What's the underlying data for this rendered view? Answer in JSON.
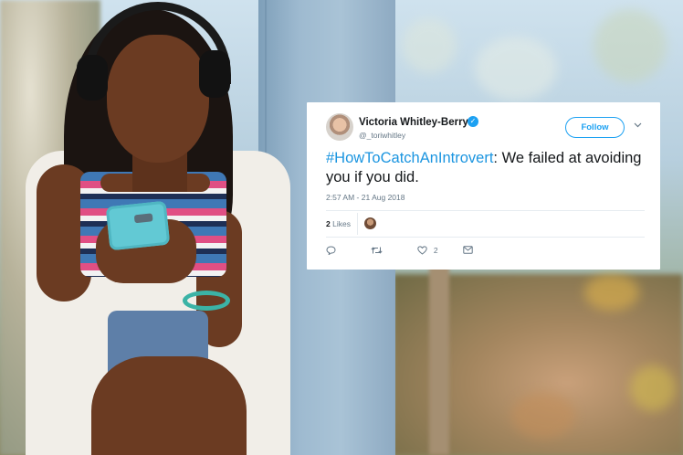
{
  "tweet": {
    "display_name": "Victoria Whitley-Berry",
    "handle": "@_toriwhitley",
    "verified_glyph": "✓",
    "follow_label": "Follow",
    "caret_glyph": "⌄",
    "hashtag": "#HowToCatchAnIntrovert",
    "body": ": We failed at avoiding you if you did.",
    "timestamp": "2:57 AM - 21 Aug 2018",
    "likes_count": "2",
    "likes_word": "Likes",
    "actions": {
      "reply_icon": "reply-icon",
      "retweet_icon": "retweet-icon",
      "like_icon": "heart-icon",
      "like_count": "2",
      "message_icon": "envelope-icon"
    }
  },
  "colors": {
    "twitter_blue": "#1da1f2",
    "hashtag_blue": "#1b95e0",
    "text_primary": "#14171a",
    "text_secondary": "#657786"
  }
}
